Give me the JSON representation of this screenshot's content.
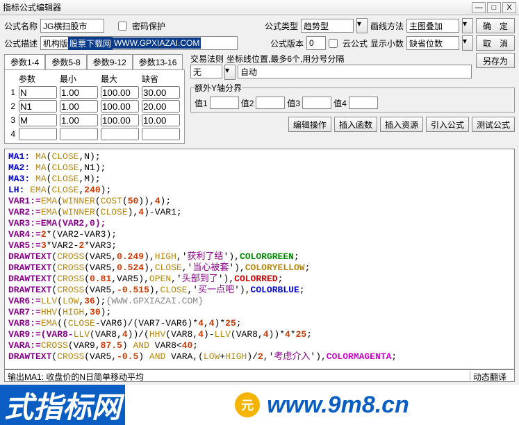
{
  "window": {
    "title": "指标公式编辑器",
    "min": "—",
    "max": "□",
    "close": "X"
  },
  "labels": {
    "name": "公式名称",
    "pwd": "密码保护",
    "type": "公式类型",
    "draw": "画线方法",
    "desc": "公式描述",
    "ver": "公式版本",
    "cloud": "云公式",
    "dec": "显示小数",
    "ok": "确　定",
    "cancel": "取　消",
    "saveas": "另存为",
    "rule": "交易法则",
    "coordHint": "坐标线位置,最多6个,用分号分隔",
    "extraY": "额外Y轴分界",
    "v1": "值1",
    "v2": "值2",
    "v3": "值3",
    "v4": "值4",
    "editop": "编辑操作",
    "insfn": "插入函数",
    "insres": "插入资源",
    "impf": "引入公式",
    "test": "测试公式",
    "paramHead": "参数",
    "minHead": "最小",
    "maxHead": "最大",
    "defHead": "缺省",
    "status": "输出MA1:  收盘价的N日简单移动平均",
    "statusR": "动态翻译"
  },
  "fields": {
    "name": "JG横扫股市",
    "descPrefix": "机构版 ",
    "descHL1": "股票下载网",
    "descHL2": "WWW.GPXIAZAI.COM",
    "type": "趋势型",
    "typeSel": "▾",
    "draw": "主图叠加",
    "drawSel": "▾",
    "ver": "0",
    "dec": "缺省位数",
    "decSel": "▾",
    "ruleVal": "无",
    "ruleSel": "▾",
    "autoVal": "自动"
  },
  "tabs": [
    "参数1-4",
    "参数5-8",
    "参数9-12",
    "参数13-16"
  ],
  "params": [
    {
      "n": "N",
      "min": "1.00",
      "max": "100.00",
      "def": "30.00"
    },
    {
      "n": "N1",
      "min": "1.00",
      "max": "100.00",
      "def": "20.00"
    },
    {
      "n": "M",
      "min": "1.00",
      "max": "100.00",
      "def": "10.00"
    },
    {
      "n": "",
      "min": "",
      "max": "",
      "def": ""
    }
  ],
  "code": {
    "l1a": "MA1: ",
    "l1b": "MA",
    "l1c": "(",
    "l1d": "CLOSE",
    "l1e": ",N);",
    "l2a": "MA2: ",
    "l2b": "MA",
    "l2c": "(",
    "l2d": "CLOSE",
    "l2e": ",N1);",
    "l3a": "MA3: ",
    "l3b": "MA",
    "l3c": "(",
    "l3d": "CLOSE",
    "l3e": ",M);",
    "l4a": "LH: ",
    "l4b": "EMA",
    "l4c": "(",
    "l4d": "CLOSE",
    "l4e": ",",
    "l4f": "240",
    "l4g": ");",
    "l5a": "VAR1:=",
    "l5b": "EMA",
    "l5c": "(",
    "l5d": "WINNER",
    "l5e": "(",
    "l5f": "COST",
    "l5g": "(",
    "l5h": "50",
    "l5i": ")),",
    "l5j": "4",
    "l5k": ");",
    "l6a": "VAR2:=",
    "l6b": "EMA",
    "l6c": "(",
    "l6d": "WINNER",
    "l6e": "(",
    "l6f": "CLOSE",
    "l6g": "),",
    "l6h": "4",
    "l6i": ")-VAR1;",
    "l7": "VAR3:=EMA(VAR2,0);",
    "l8a": "VAR4:=",
    "l8b": "2",
    "l8c": "*(VAR2-VAR3);",
    "l9a": "VAR5:=",
    "l9b": "3",
    "l9c": "*VAR2-",
    "l9d": "2",
    "l9e": "*VAR3;",
    "l10a": "DRAWTEXT",
    "l10b": "(",
    "l10c": "CROSS",
    "l10d": "(VAR5,",
    "l10e": "0.249",
    "l10f": "),",
    "l10g": "HIGH",
    "l10h": ",'",
    "l10i": "获利了结",
    "l10j": "'),",
    "l10k": "COLORGREEN",
    "l10l": ";",
    "l11a": "DRAWTEXT",
    "l11b": "(",
    "l11c": "CROSS",
    "l11d": "(VAR5,",
    "l11e": "0.524",
    "l11f": "),",
    "l11g": "CLOSE",
    "l11h": ",'",
    "l11i": "当心被套",
    "l11j": "'),",
    "l11k": "COLORYELLOW",
    "l11l": ";",
    "l12a": "DRAWTEXT",
    "l12b": "(",
    "l12c": "CROSS",
    "l12d": "(",
    "l12e": "0.81",
    "l12f": ",VAR5),",
    "l12g": "OPEN",
    "l12h": ",'",
    "l12i": "头部到了",
    "l12j": "'),",
    "l12k": "COLORRED",
    "l12l": ";",
    "l13a": "DRAWTEXT",
    "l13b": "(",
    "l13c": "CROSS",
    "l13d": "(VAR5,",
    "l13e": "-0.515",
    "l13f": "),",
    "l13g": "CLOSE",
    "l13h": ",'",
    "l13i": "买一点吧",
    "l13j": "'),",
    "l13k": "COLORBLUE",
    "l13l": ";",
    "l14a": "VAR6:=",
    "l14b": "LLV",
    "l14c": "(",
    "l14d": "LOW",
    "l14e": ",",
    "l14f": "36",
    "l14g": ");",
    "l14h": "{WWW.GPXIAZAI.COM}",
    "l15a": "VAR7:=",
    "l15b": "HHV",
    "l15c": "(",
    "l15d": "HIGH",
    "l15e": ",",
    "l15f": "30",
    "l15g": ");",
    "l16a": "VAR8:=",
    "l16b": "EMA",
    "l16c": "((",
    "l16d": "CLOSE",
    "l16e": "-VAR6)/(VAR7-VAR6)*",
    "l16f": "4",
    "l16g": ",",
    "l16h": "4",
    "l16i": ")*",
    "l16j": "25",
    "l16k": ";",
    "l17a": "VAR9:=(VAR8-",
    "l17b": "LLV",
    "l17c": "(VAR8,",
    "l17d": "4",
    "l17e": "))/(",
    "l17f": "HHV",
    "l17g": "(VAR8,",
    "l17h": "4",
    "l17i": ")-",
    "l17j": "LLV",
    "l17k": "(VAR8,",
    "l17l": "4",
    "l17m": "))*",
    "l17n": "4",
    "l17o": "*",
    "l17p": "25",
    "l17q": ";",
    "l18a": "VARA:=",
    "l18b": "CROSS",
    "l18c": "(VAR9,",
    "l18d": "87.5",
    "l18e": ") ",
    "l18f": "AND",
    "l18g": " VAR8<",
    "l18h": "40",
    "l18i": ";",
    "l19a": "DRAWTEXT",
    "l19b": "(",
    "l19c": "CROSS",
    "l19d": "(VAR5,",
    "l19e": "-0.5",
    "l19f": ") ",
    "l19g": "AND",
    "l19h": " VARA,(",
    "l19i": "LOW",
    "l19j": "+",
    "l19k": "HIGH",
    "l19l": ")/",
    "l19m": "2",
    "l19n": ",'",
    "l19o": "考虑介入",
    "l19p": "'),",
    "l19q": "COLORMAGENTA",
    "l19r": ";"
  },
  "banner": {
    "left": "式指标网",
    "url": "www.9m8.cn",
    "logo": "元"
  }
}
